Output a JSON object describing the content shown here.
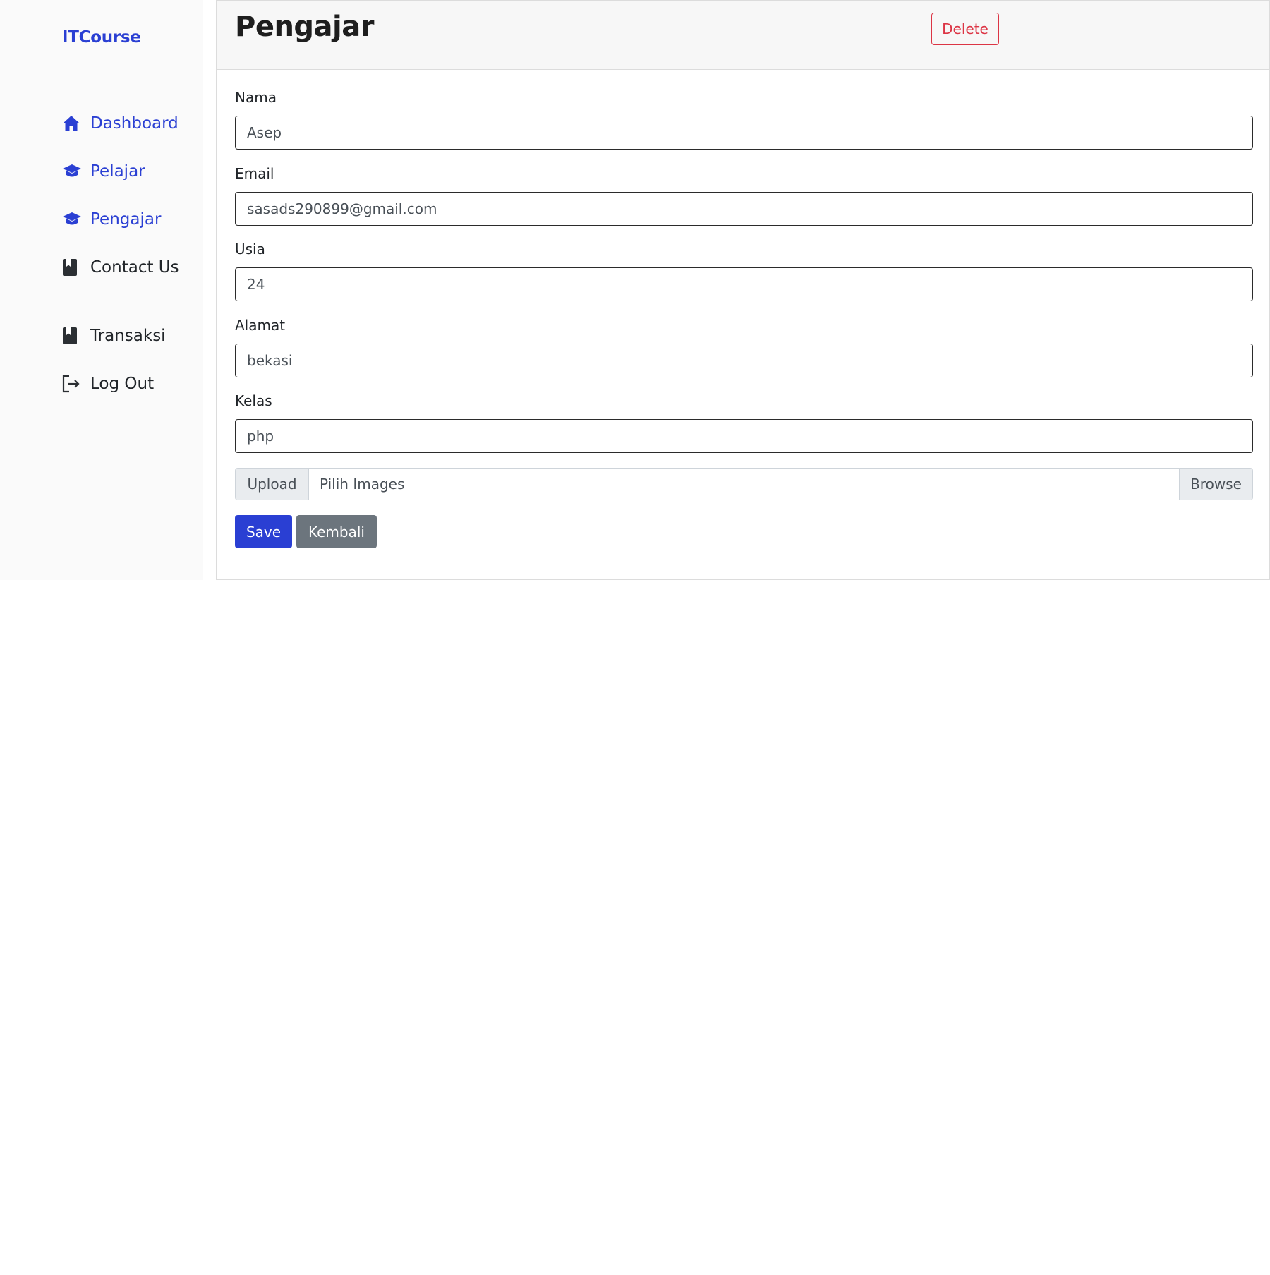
{
  "sidebar": {
    "brand": "ITCourse",
    "items": [
      {
        "label": "Dashboard",
        "icon": "home-icon",
        "active": true
      },
      {
        "label": "Pelajar",
        "icon": "graduation-cap-icon",
        "active": true
      },
      {
        "label": "Pengajar",
        "icon": "graduation-cap-icon",
        "active": true
      },
      {
        "label": "Contact Us",
        "icon": "book-icon",
        "active": false
      },
      {
        "label": "Transaksi",
        "icon": "book-icon",
        "active": false
      },
      {
        "label": "Log Out",
        "icon": "logout-icon",
        "active": false
      }
    ]
  },
  "header": {
    "title": "Pengajar",
    "delete_label": "Delete"
  },
  "form": {
    "nama": {
      "label": "Nama",
      "value": "Asep"
    },
    "email": {
      "label": "Email",
      "value": "sasads290899@gmail.com"
    },
    "usia": {
      "label": "Usia",
      "value": "24"
    },
    "alamat": {
      "label": "Alamat",
      "value": "bekasi"
    },
    "kelas": {
      "label": "Kelas",
      "value": "php"
    },
    "upload": {
      "prepend": "Upload",
      "placeholder": "Pilih Images",
      "browse": "Browse"
    },
    "save_label": "Save",
    "back_label": "Kembali"
  },
  "colors": {
    "primary": "#2a3fd3",
    "danger": "#dc3545",
    "secondary": "#6c757d"
  }
}
